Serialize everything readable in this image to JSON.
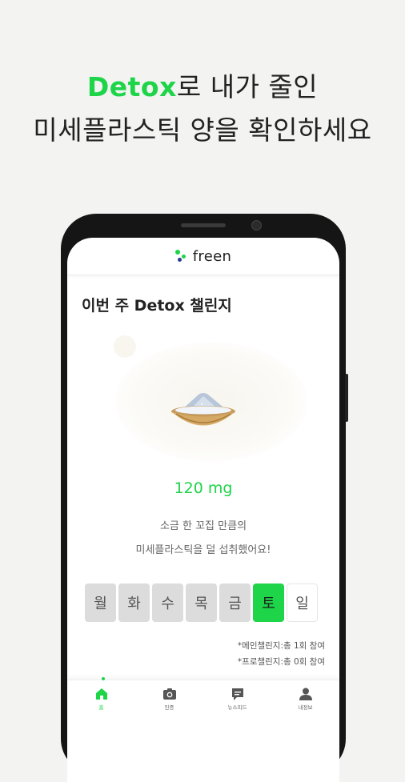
{
  "headline": {
    "accent": "Detox",
    "line1_rest": "로 내가 줄인",
    "line2": "미세플라스틱 양을 확인하세요"
  },
  "app": {
    "logo_text": "freen",
    "challenge_title": "이번 주 Detox 챌린지",
    "amount": "120 mg",
    "description": [
      "소금 한 꼬집 만큼의",
      "미세플라스틱을 덜 섭취했어요!"
    ],
    "days": [
      {
        "label": "월",
        "state": "done"
      },
      {
        "label": "화",
        "state": "done"
      },
      {
        "label": "수",
        "state": "done"
      },
      {
        "label": "목",
        "state": "done"
      },
      {
        "label": "금",
        "state": "done"
      },
      {
        "label": "토",
        "state": "today"
      },
      {
        "label": "일",
        "state": "upcoming"
      }
    ],
    "notes": [
      "*메인챌린지:총 1회 참여",
      "*프로챌린지:총 0회 참여"
    ],
    "nav": [
      {
        "label": "홈",
        "icon": "home-icon",
        "active": true
      },
      {
        "label": "인증",
        "icon": "camera-icon",
        "active": false
      },
      {
        "label": "뉴스피드",
        "icon": "chat-icon",
        "active": false
      },
      {
        "label": "내정보",
        "icon": "user-icon",
        "active": false
      }
    ]
  },
  "colors": {
    "accent": "#1ed449",
    "background": "#f3f3f2"
  }
}
